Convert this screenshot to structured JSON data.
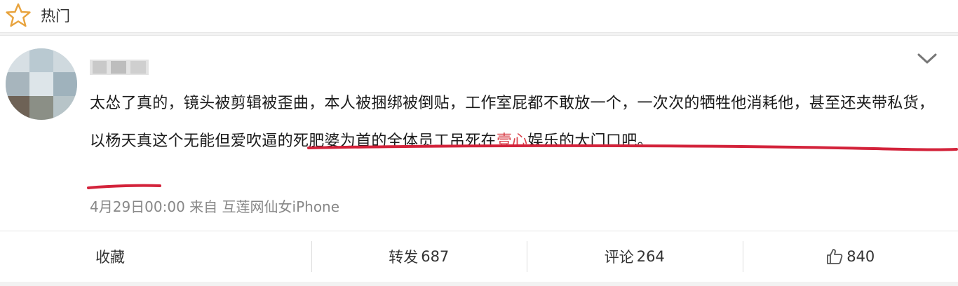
{
  "header": {
    "title": "热门",
    "icon": "star-icon"
  },
  "post": {
    "username": "",
    "content_before": "太怂了真的，镜头被剪辑被歪曲，本人被捆绑被倒贴，工作室屁都不敢放一个，一次次的牺牲他消耗他，甚至还夹带私货，以杨天真这个无能但爱吹逼的死肥婆为首的全体员工吊死在",
    "content_red": "壹心",
    "content_after": "娱乐的大门口吧。",
    "meta": "4月29日00:00 来自 互莲网仙女iPhone",
    "colors": {
      "highlight": "#d9424b",
      "underline": "#d3223a",
      "meta": "#888888"
    }
  },
  "actions": {
    "collect_label": "收藏",
    "repost_label": "转发",
    "repost_count": "687",
    "comment_label": "评论",
    "comment_count": "264",
    "like_count": "840"
  }
}
